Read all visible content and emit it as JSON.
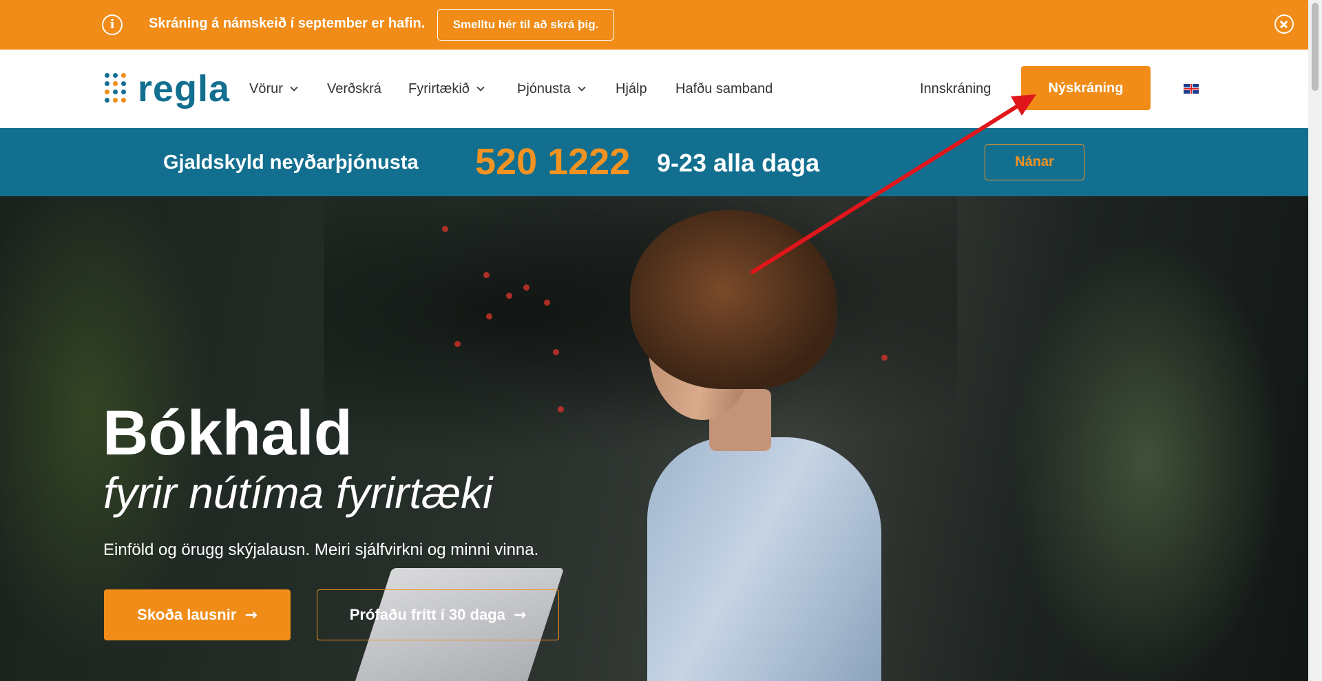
{
  "announcement": {
    "info_icon": "info-icon",
    "message": "Skráning á námskeið í september er hafin.",
    "cta_label": "Smelltu hér til að skrá þig.",
    "close_icon": "close-circle-icon"
  },
  "header": {
    "logo_text": "regla",
    "nav": [
      {
        "label": "Vörur",
        "has_dropdown": true
      },
      {
        "label": "Verðskrá",
        "has_dropdown": false
      },
      {
        "label": "Fyrirtækið",
        "has_dropdown": true
      },
      {
        "label": "Þjónusta",
        "has_dropdown": true
      },
      {
        "label": "Hjálp",
        "has_dropdown": false
      },
      {
        "label": "Hafðu samband",
        "has_dropdown": false
      }
    ],
    "login_label": "Innskráning",
    "signup_label": "Nýskráning",
    "language_icon": "uk-flag-icon"
  },
  "emergency": {
    "label": "Gjaldskyld neyðarþjónusta",
    "phone": "520 1222",
    "hours": "9-23 alla daga",
    "more_label": "Nánar"
  },
  "hero": {
    "title": "Bókhald",
    "subtitle": "fyrir nútíma fyrirtæki",
    "description": "Einföld og örugg skýjalausn. Meiri sjálfvirkni og minni vinna.",
    "primary_cta": "Skoða lausnir",
    "secondary_cta": "Prófaðu frítt í 30 daga",
    "arrow_glyph": "→"
  },
  "colors": {
    "brand_orange": "#f08c17",
    "brand_teal": "#126f8f",
    "annotation_red": "#e0161b"
  }
}
